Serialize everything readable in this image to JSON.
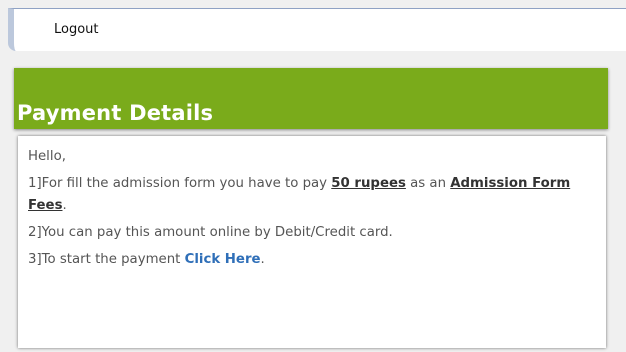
{
  "topbar": {
    "logout_label": "Logout"
  },
  "panel": {
    "title": "Payment Details",
    "greeting": "Hello,",
    "item1": {
      "prefix": "1]For fill the admission form you have to pay ",
      "amount": "50 rupees",
      "middle": " as an ",
      "fee_name": "Admission Form Fees",
      "suffix": "."
    },
    "item2": "2]You can pay this amount online by Debit/Credit card.",
    "item3": {
      "prefix": "3]To start the payment ",
      "link_label": "Click Here",
      "suffix": "."
    }
  },
  "colors": {
    "header_green": "#7aab1b",
    "link_blue": "#2f6fb8"
  }
}
